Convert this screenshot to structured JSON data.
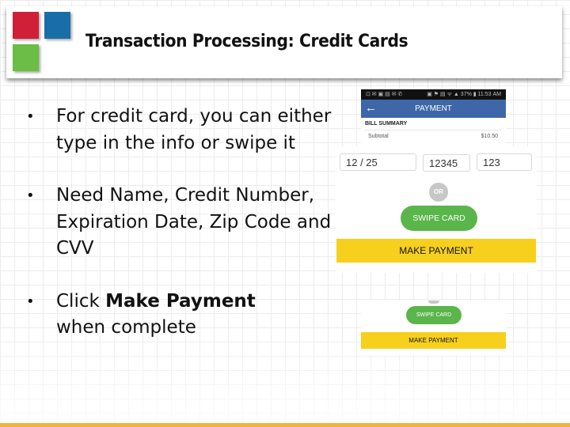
{
  "slide": {
    "title": "Transaction Processing: Credit Cards",
    "accent_colors": {
      "logo_red": "#cf2038",
      "logo_blue": "#1a6ea8",
      "logo_green": "#6bbd45",
      "bottom_bar": "#f0b43c"
    },
    "bullets": [
      {
        "text": "For credit card, you can either type in the info or swipe it"
      },
      {
        "text": "Need Name, Credit Number, Expiration Date, Zip Code and CVV"
      },
      {
        "prefix": "Click ",
        "bold": "Make Payment",
        "suffix": " when complete"
      }
    ],
    "bullet_glyph": "•"
  },
  "phone_top": {
    "status_left": "⊡ ✉ ▣ ▤ ✉ ✆",
    "status_right": "▣ ⚑ ▤ ᯤ ▲ 37% ▮ 11:53 AM",
    "back_icon": "←",
    "title": "PAYMENT",
    "bill_summary_label": "BILL SUMMARY",
    "subtotal_label": "Subtotal",
    "subtotal_value": "$10.50"
  },
  "payment_form": {
    "expiration_value": "12 / 25",
    "zip_value": "12345",
    "cvv_value": "123",
    "or_label": "OR",
    "swipe_label": "SWIPE CARD",
    "make_payment_label": "MAKE PAYMENT"
  },
  "phone_bottom": {
    "swipe_label": "SWIPE CARD",
    "make_payment_label": "MAKE PAYMENT"
  }
}
